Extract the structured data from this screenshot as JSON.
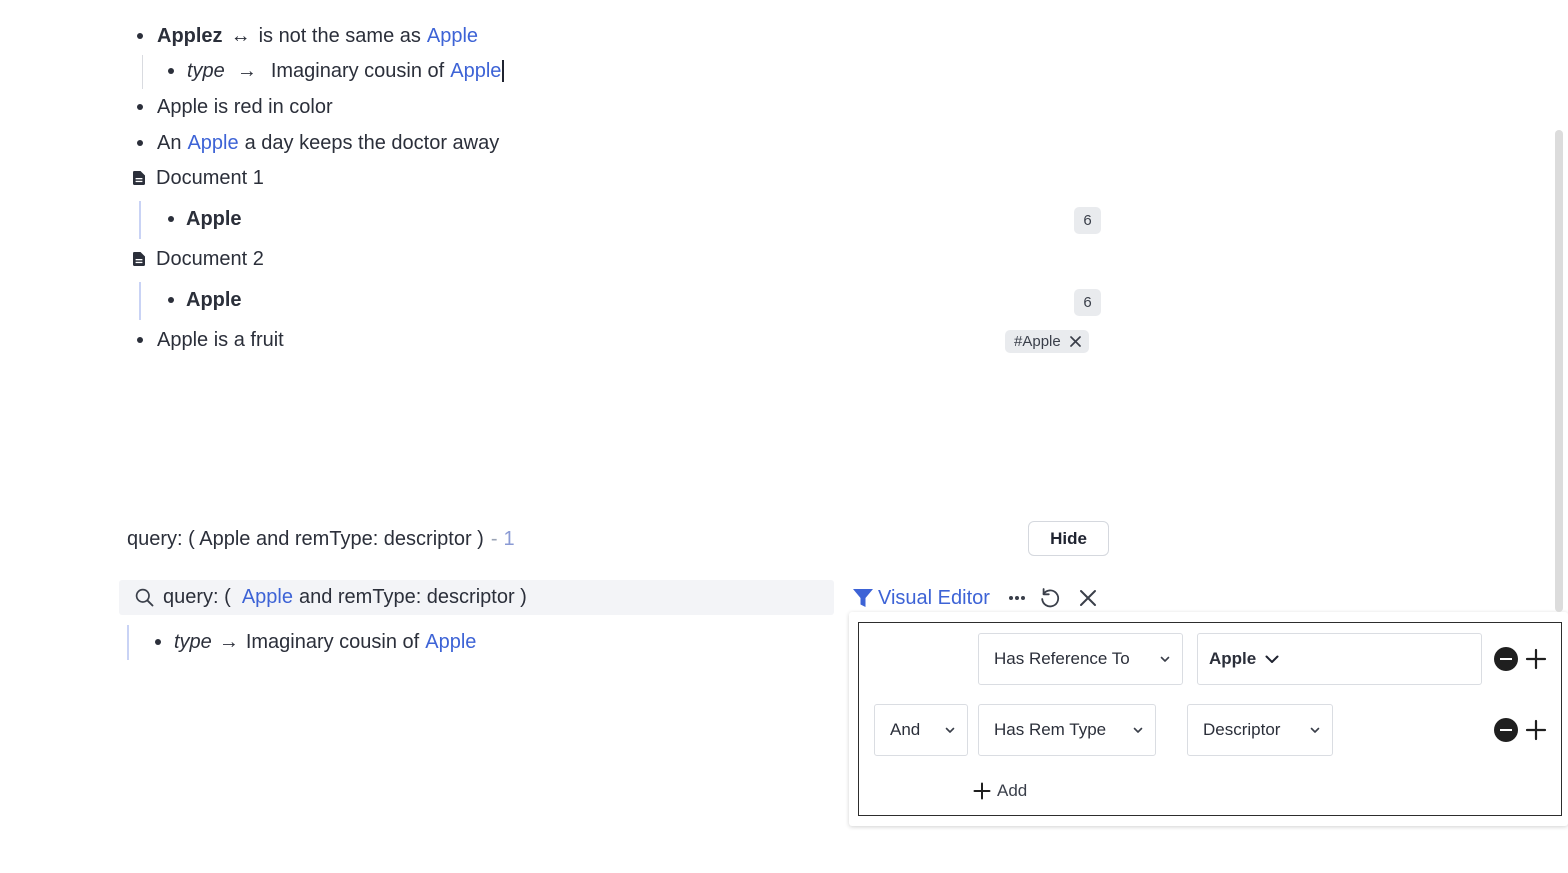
{
  "outline": {
    "row1": {
      "name": "Applez",
      "arrow": "↔",
      "text": "is not the same as",
      "link": "Apple"
    },
    "row2": {
      "property": "type",
      "arrow": "→",
      "text": "Imaginary cousin of",
      "link": "Apple"
    },
    "row3": {
      "text": "Apple is red in color"
    },
    "row4": {
      "pre": "An",
      "link": "Apple",
      "post": "a day keeps the doctor away"
    },
    "doc1": {
      "title": "Document 1",
      "child": "Apple",
      "count": "6"
    },
    "doc2": {
      "title": "Document 2",
      "child": "Apple",
      "count": "6"
    },
    "row5": {
      "text": "Apple is a fruit",
      "tag": "#Apple"
    }
  },
  "query": {
    "header_label": "query: ( Apple and remType: descriptor )",
    "header_sep": "-",
    "result_count": "1",
    "hide_label": "Hide",
    "search_prefix": "query: (",
    "search_link": "Apple",
    "search_suffix": "and remType: descriptor )",
    "result": {
      "property": "type",
      "arrow": "→",
      "text": "Imaginary cousin of",
      "link": "Apple"
    }
  },
  "toolbar": {
    "visual_editor_label": "Visual Editor"
  },
  "visual_editor": {
    "row1": {
      "condition": "Has Reference To",
      "value": "Apple"
    },
    "row2": {
      "operator": "And",
      "condition": "Has Rem Type",
      "value": "Descriptor"
    },
    "add_label": "Add"
  },
  "colors": {
    "link": "#3d63d6",
    "text": "#2b2f3a",
    "accent_line": "#c9d3f5",
    "badge_bg": "#e9ebee"
  }
}
